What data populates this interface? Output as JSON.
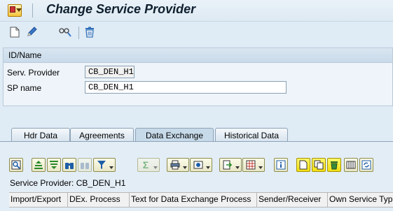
{
  "window": {
    "title": "Change Service Provider"
  },
  "toolbar": {
    "icons": [
      "new-document-icon",
      "edit-pencil-icon",
      "display-change-icon",
      "delete-trash-icon"
    ]
  },
  "header_panel": {
    "heading": "ID/Name",
    "serv_provider_label": "Serv. Provider",
    "serv_provider_value": "CB_DEN_H1",
    "sp_name_label": "SP name",
    "sp_name_value": "CB_DEN_H1"
  },
  "tabs": [
    {
      "label": "Hdr Data"
    },
    {
      "label": "Agreements"
    },
    {
      "label": "Data Exchange"
    },
    {
      "label": "Historical Data"
    }
  ],
  "active_tab": "Data Exchange",
  "grid": {
    "caption": "Service Provider: CB_DEN_H1",
    "columns": [
      "Import/Export",
      "DEx. Process",
      "Text for Data Exchange Process",
      "Sender/Receiver",
      "Own Service Type"
    ]
  },
  "colors": {
    "background": "#dfebf5",
    "highlight_button": "#f6e522",
    "title_text": "#0f1f2e"
  }
}
